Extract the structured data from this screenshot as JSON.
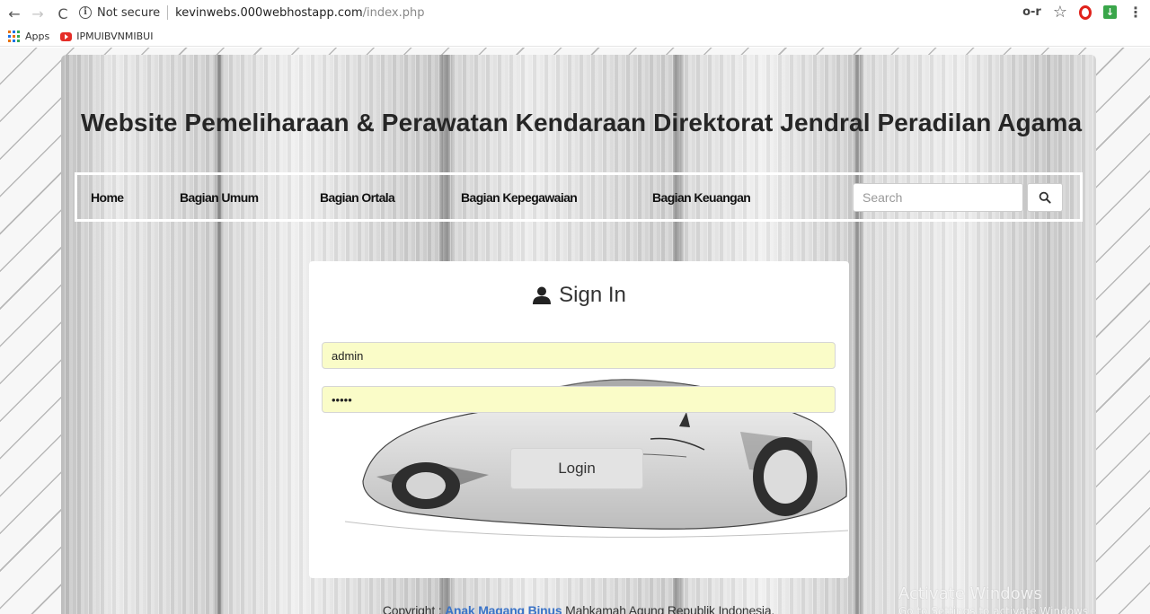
{
  "browser": {
    "security_label": "Not secure",
    "url_host": "kevinwebs.000webhostapp.com",
    "url_path": "/index.php",
    "back_icon": "←",
    "forward_icon": "→",
    "reload_icon": "C",
    "bookmarks": [
      {
        "label": "Apps",
        "icon": "apps-grid-icon"
      },
      {
        "label": "IPMUIBVNMIBUI",
        "icon": "youtube-icon"
      }
    ]
  },
  "site": {
    "title": "Website Pemeliharaan & Perawatan Kendaraan Direktorat Jendral Peradilan Agama",
    "nav": [
      {
        "label": "Home"
      },
      {
        "label": "Bagian Umum"
      },
      {
        "label": "Bagian Ortala"
      },
      {
        "label": "Bagian Kepegawaian"
      },
      {
        "label": "Bagian Keuangan"
      }
    ],
    "search": {
      "placeholder": "Search",
      "icon": "search-icon"
    }
  },
  "signin": {
    "title": "Sign In",
    "icon": "user-icon",
    "username": "admin",
    "password": "•••••",
    "login_label": "Login"
  },
  "footer": {
    "prefix": "Copyright : ",
    "brand": "Anak Magang Binus",
    "suffix": " Mahkamah Agung Republik Indonesia."
  },
  "watermark": {
    "line1": "Activate Windows",
    "line2": "Go to Settings to activate Windows."
  },
  "colors": {
    "field_autofill": "#fafcc8",
    "footer_brand": "#3b73c7",
    "login_button": "#e3e3e3"
  }
}
